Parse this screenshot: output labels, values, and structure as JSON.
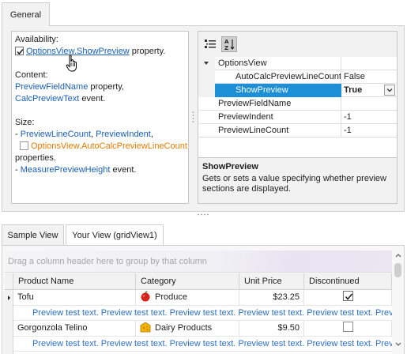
{
  "top_tab": {
    "label": "General"
  },
  "description": {
    "availability_label": "Availability:",
    "show_preview_checked": true,
    "show_preview_link": "OptionsView.ShowPreview",
    "show_preview_suffix": "property.",
    "content_label": "Content:",
    "preview_field_name_link": "PreviewFieldName",
    "preview_field_name_suffix": "property,",
    "calc_preview_text_link": "CalcPreviewText",
    "calc_preview_text_suffix": "event.",
    "size_label": "Size:",
    "dash": "- ",
    "preview_line_count_link": "PreviewLineCount",
    "comma": ", ",
    "preview_indent_link": "PreviewIndent",
    "comma_end": ",",
    "auto_calc_checked": false,
    "auto_calc_link": "OptionsView.AutoCalcPreviewLineCount",
    "properties_text": "properties.",
    "measure_preview_height_link": "MeasurePreviewHeight",
    "measure_suffix": "event."
  },
  "property_grid": {
    "toolbar": {
      "categorized_icon": "categorized-icon",
      "alphabetical_icon": "alphabetical-sort-icon"
    },
    "rows": [
      {
        "name": "OptionsView",
        "value": "",
        "expanded": true
      },
      {
        "name": "AutoCalcPreviewLineCount",
        "value": "False"
      },
      {
        "name": "ShowPreview",
        "value": "True",
        "selected": true
      },
      {
        "name": "PreviewFieldName",
        "value": ""
      },
      {
        "name": "PreviewIndent",
        "value": "-1"
      },
      {
        "name": "PreviewLineCount",
        "value": "-1"
      }
    ],
    "desc_title": "ShowPreview",
    "desc_text": "Gets or sets a value specifying whether preview sections are displayed."
  },
  "bottom_tabs": [
    {
      "label": "Sample View",
      "active": false
    },
    {
      "label": "Your View (gridView1)",
      "active": true
    }
  ],
  "grid": {
    "group_panel_text": "Drag a column header here to group by that column",
    "columns": [
      "Product Name",
      "Category",
      "Unit Price",
      "Discontinued"
    ],
    "rows": [
      {
        "product": "Tofu",
        "category": "Produce",
        "category_icon": "apple-icon",
        "price": "$23.25",
        "discontinued": true,
        "focused": true,
        "preview": "Preview test text. Preview test text. Preview test text. Preview test text. Preview test text. Preview test text."
      },
      {
        "product": "Gorgonzola Telino",
        "category": "Dairy Products",
        "category_icon": "cheese-icon",
        "price": "$9.50",
        "discontinued": false,
        "focused": false,
        "preview": "Preview test text. Preview test text. Preview test text. Preview test text. Preview test text. Preview test text."
      }
    ]
  },
  "colors": {
    "accent": "#1c8fd6",
    "link": "#1a5fb4",
    "orange_link": "#e07b00",
    "preview_text": "#2d6fbf"
  }
}
